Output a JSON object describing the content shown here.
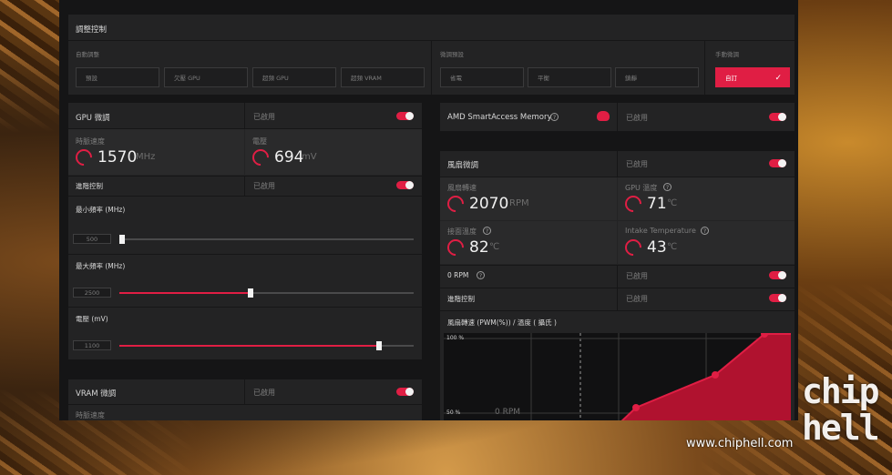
{
  "tuning": {
    "title": "調整控制",
    "auto_label": "自動調整",
    "auto_buttons": [
      "預設",
      "欠壓 GPU",
      "超頻 GPU",
      "超頻 VRAM"
    ],
    "preset_label": "微調預設",
    "preset_buttons": [
      "省電",
      "平衡",
      "鎮靜"
    ],
    "manual_label": "手動微調",
    "manual_button": "自訂",
    "check_icon": "✓"
  },
  "gpu": {
    "title": "GPU 微調",
    "status": "已啟用",
    "clock_label": "時脈速度",
    "clock_value": "1570",
    "clock_unit": "MHz",
    "voltage_label": "電壓",
    "voltage_value": "694",
    "voltage_unit": "mV",
    "advanced_label": "進階控制",
    "advanced_status": "已啟用",
    "min_freq_label": "最小頻率 (MHz)",
    "min_freq_value": "500",
    "min_freq_fraction": 0.0,
    "max_freq_label": "最大頻率 (MHz)",
    "max_freq_value": "2500",
    "max_freq_fraction": 0.45,
    "volt_label": "電壓 (mV)",
    "volt_value": "1100",
    "volt_fraction": 0.88
  },
  "vram": {
    "title": "VRAM 微調",
    "status": "已啟用",
    "clock_label": "時脈速度"
  },
  "sam": {
    "title": "AMD SmartAccess Memory",
    "status": "已啟用"
  },
  "fan": {
    "title": "風扇微調",
    "status": "已啟用",
    "speed_label": "風扇轉速",
    "speed_value": "2070",
    "speed_unit": "RPM",
    "gpu_temp_label": "GPU 溫度",
    "gpu_temp_value": "71",
    "junction_label": "接面溫度",
    "junction_value": "82",
    "intake_label": "Intake Temperature",
    "intake_value": "43",
    "temp_unit": "℃",
    "zero_rpm_label": "0 RPM",
    "zero_rpm_status": "已啟用",
    "advanced_label": "進階控制",
    "advanced_status": "已啟用",
    "curve_title": "風扇轉速 (PWM(%)) / 溫度 ( 攝氏 )",
    "y_top": "100 %",
    "y_mid": "50 %",
    "zero_rpm_marker": "0 RPM"
  },
  "colors": {
    "accent": "#e01e44",
    "panel": "#232324",
    "bg": "#151516"
  },
  "watermark": "www.chiphell.com",
  "logo_text": "chip hell"
}
